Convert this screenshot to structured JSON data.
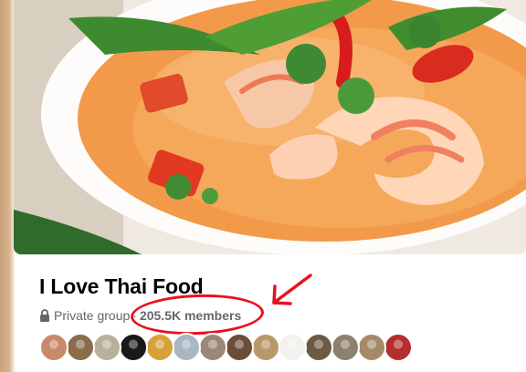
{
  "group": {
    "name": "I Love Thai Food",
    "privacy": "Private group",
    "separator": "·",
    "members": "205.5K members"
  },
  "icons": {
    "privacy_icon": "lock-icon",
    "annotation_icon": "red-arrow-icon"
  },
  "colors": {
    "title": "#050505",
    "meta": "#65676b",
    "annotation": "#e8121f"
  },
  "avatars": [
    {
      "color": "#c98a6a"
    },
    {
      "color": "#8a6b4a"
    },
    {
      "color": "#b8b09a"
    },
    {
      "color": "#1a1a1a"
    },
    {
      "color": "#d7a13a"
    },
    {
      "color": "#a9b7c2"
    },
    {
      "color": "#9c8677"
    },
    {
      "color": "#6b4e3a"
    },
    {
      "color": "#b89a6a"
    },
    {
      "color": "#f3f1ee"
    },
    {
      "color": "#6d5a44"
    },
    {
      "color": "#8c8070"
    },
    {
      "color": "#a58a6a"
    },
    {
      "color": "#b52e2e"
    }
  ]
}
